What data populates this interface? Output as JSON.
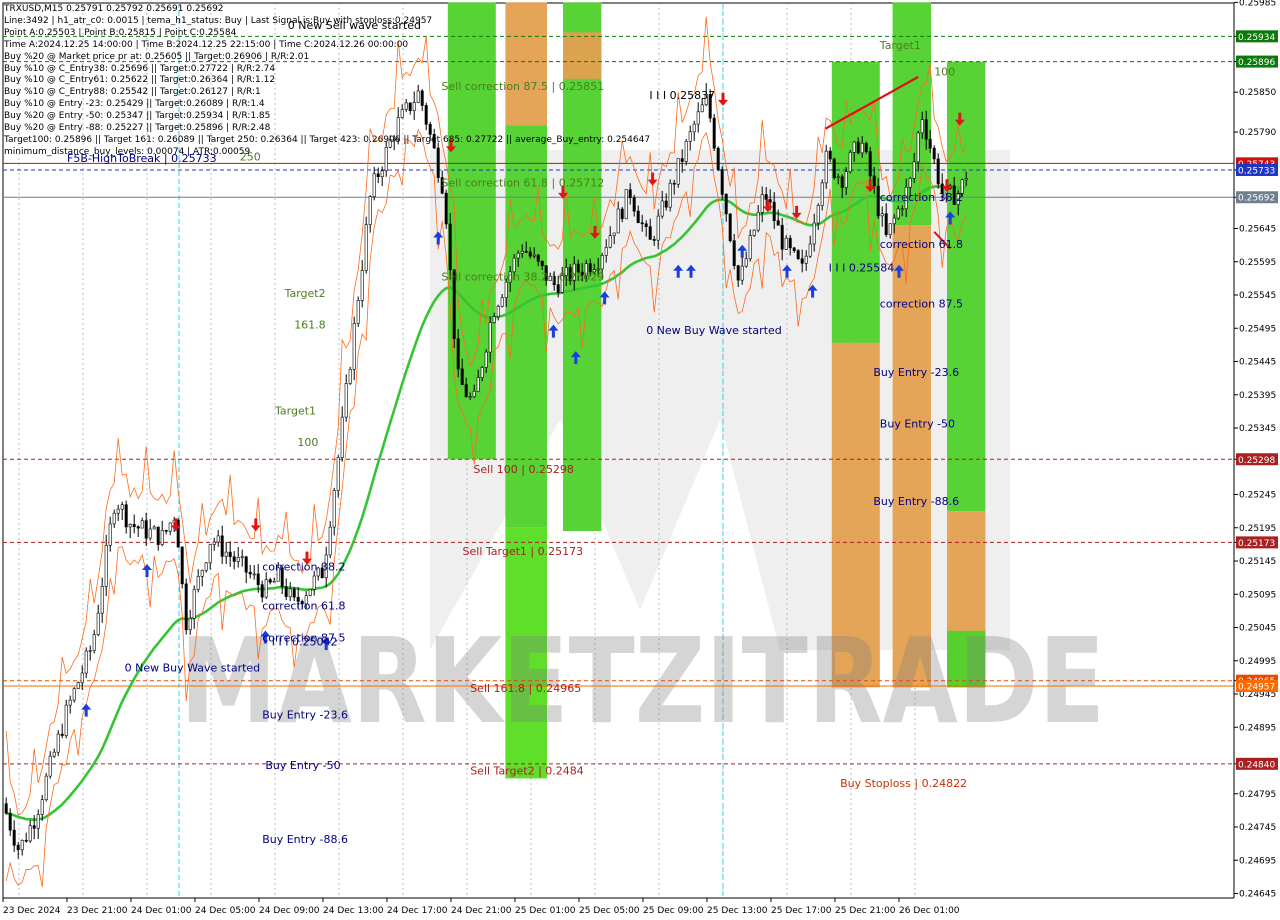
{
  "chart_data": {
    "type": "candlestick",
    "symbol_line": "TRXUSD,M15  0.25791 0.25792 0.25691 0.25692",
    "info_lines": [
      "Line:3492 | h1_atr_c0: 0.0015 | tema_h1_status: Buy | Last Signal is:Buy with stoploss:0.24957",
      "Point A:0.25503 | Point B:0.25815 | Point C:0.25584",
      "Time A:2024.12.25 14:00:00 | Time B:2024.12.25 22:15:00 | Time C:2024.12.26 00:00:00",
      "Buy %20 @ Market price pr at: 0.25605 || Target:0.26906 | R/R:2.01",
      "Buy %10 @ C_Entry38: 0.25696 || Target:0.27722 | R/R:2.74",
      "Buy %10 @ C_Entry61: 0.25622 || Target:0.26364 | R/R:1.12",
      "Buy %10 @ C_Entry88: 0.25542 || Target:0.26127 | R/R:1",
      "Buy %10 @ Entry -23: 0.25429 || Target:0.26089 | R/R:1.4",
      "Buy %20 @ Entry -50: 0.25347 || Target:0.25934 | R/R:1.85",
      "Buy %20 @ Entry -88: 0.25227 || Target:0.25896 | R/R:2.48",
      "Target100: 0.25896 || Target 161: 0.26089 || Target 250: 0.26364 || Target 423: 0.26906 || Target 685: 0.27722 || average_Buy_entry: 0.254647",
      "minimum_distance_buy_levels: 0.00074 | ATR:0.00059"
    ],
    "ylim": [
      0.24645,
      0.25985
    ],
    "y_ticks": [
      "0.25985",
      "0.25934",
      "0.25896",
      "0.25850",
      "0.25790",
      "0.25733",
      "0.25692",
      "0.25645",
      "0.25595",
      "0.25545",
      "0.25495",
      "0.25445",
      "0.25395",
      "0.25345",
      "0.25298",
      "0.25245",
      "0.25195",
      "0.25173",
      "0.25145",
      "0.25095",
      "0.25045",
      "0.24995",
      "0.24965",
      "0.24945",
      "0.24895",
      "0.24840",
      "0.24795",
      "0.24745",
      "0.24695",
      "0.24645"
    ],
    "x_ticks": [
      "23 Dec 2024",
      "23 Dec 21:00",
      "24 Dec 01:00",
      "24 Dec 05:00",
      "24 Dec 09:00",
      "24 Dec 13:00",
      "24 Dec 17:00",
      "24 Dec 21:00",
      "25 Dec 01:00",
      "25 Dec 05:00",
      "25 Dec 09:00",
      "25 Dec 13:00",
      "25 Dec 17:00",
      "25 Dec 21:00",
      "26 Dec 01:00"
    ],
    "price_levels": [
      {
        "price": 0.25934,
        "label": "0.25934",
        "color": "#0a7a0a",
        "style": "dashed"
      },
      {
        "price": 0.25896,
        "label": "0.25896",
        "color": "#0a7a0a",
        "style": "dashed"
      },
      {
        "price": 0.25743,
        "label": "0.25743",
        "color": "#cc1010",
        "style": "solid"
      },
      {
        "price": 0.25733,
        "label": "0.25733",
        "color": "#1f35c9",
        "style": "dashed"
      },
      {
        "price": 0.25692,
        "label": "0.25692",
        "color": "#6f7f8f",
        "style": "solid"
      },
      {
        "price": 0.25298,
        "label": "0.25298",
        "color": "#aa2020",
        "style": "dashed"
      },
      {
        "price": 0.25173,
        "label": "0.25173",
        "color": "#aa2020",
        "style": "dashed"
      },
      {
        "price": 0.24965,
        "label": "0.24965",
        "color": "#e44a00",
        "style": "dashed"
      },
      {
        "price": 0.24957,
        "label": "0.24957",
        "color": "#ff6a00",
        "style": "solid"
      },
      {
        "price": 0.2484,
        "label": "0.24840",
        "color": "#aa2020",
        "style": "dashed"
      }
    ],
    "annotations": [
      {
        "text": "0 New Sell wave started",
        "price": 0.25945,
        "time": 4.45,
        "color": "#000000"
      },
      {
        "text": "Target1",
        "price": 0.25915,
        "time": 13.7,
        "color": "#4a7d20"
      },
      {
        "text": "100",
        "price": 0.25875,
        "time": 14.55,
        "color": "#4a7d20"
      },
      {
        "text": "250",
        "price": 0.25747,
        "time": 3.7,
        "color": "#4a7d20"
      },
      {
        "text": "F5B-HighToBreak | 0.25733",
        "price": 0.25745,
        "time": 1.0,
        "color": "#000080"
      },
      {
        "text": "I I I 0.25837",
        "price": 0.2584,
        "time": 10.1,
        "color": "#000000"
      },
      {
        "text": "Sell correction 87.5 | 0.25851",
        "price": 0.25853,
        "time": 6.85,
        "color": "#4a7d20"
      },
      {
        "text": "Sell correction 61.8 | 0.25712",
        "price": 0.25708,
        "time": 6.85,
        "color": "#4a7d20"
      },
      {
        "text": "Sell correction 38.2 | 0.25629",
        "price": 0.25567,
        "time": 6.85,
        "color": "#4a7d20"
      },
      {
        "text": "Target2",
        "price": 0.25542,
        "time": 4.4,
        "color": "#4a7d20"
      },
      {
        "text": "161.8",
        "price": 0.25495,
        "time": 4.55,
        "color": "#4a7d20"
      },
      {
        "text": "Target1",
        "price": 0.25365,
        "time": 4.25,
        "color": "#4a7d20"
      },
      {
        "text": "100",
        "price": 0.25318,
        "time": 4.6,
        "color": "#4a7d20"
      },
      {
        "text": "0 New Buy Wave started",
        "price": 0.25486,
        "time": 10.05,
        "color": "#000080"
      },
      {
        "text": "I I I 0.25584",
        "price": 0.2558,
        "time": 12.9,
        "color": "#000080"
      },
      {
        "text": "correction 38.2",
        "price": 0.25686,
        "time": 13.7,
        "color": "#000080"
      },
      {
        "text": "correction 61.8",
        "price": 0.25616,
        "time": 13.7,
        "color": "#000080"
      },
      {
        "text": "correction 87.5",
        "price": 0.25526,
        "time": 13.7,
        "color": "#000080"
      },
      {
        "text": "Buy Entry -23.6",
        "price": 0.25423,
        "time": 13.6,
        "color": "#000080"
      },
      {
        "text": "Buy Entry -50",
        "price": 0.25346,
        "time": 13.7,
        "color": "#000080"
      },
      {
        "text": "Buy Entry -88.6",
        "price": 0.25229,
        "time": 13.6,
        "color": "#000080"
      },
      {
        "text": "Sell 100 | 0.25298",
        "price": 0.25277,
        "time": 7.35,
        "color": "#aa2020"
      },
      {
        "text": "Sell Target1 | 0.25173",
        "price": 0.25154,
        "time": 7.18,
        "color": "#aa2020"
      },
      {
        "text": "Sell 161.8 | 0.24965",
        "price": 0.24948,
        "time": 7.3,
        "color": "#aa2020"
      },
      {
        "text": "Sell Target2 | 0.2484",
        "price": 0.24824,
        "time": 7.3,
        "color": "#aa2020"
      },
      {
        "text": "Buy Stoploss | 0.24822",
        "price": 0.24805,
        "time": 13.08,
        "color": "#cc3000"
      },
      {
        "text": "correction 38.2",
        "price": 0.25131,
        "time": 4.05,
        "color": "#000080"
      },
      {
        "text": "correction 61.8",
        "price": 0.25072,
        "time": 4.05,
        "color": "#000080"
      },
      {
        "text": "I I I 0.25042",
        "price": 0.25018,
        "time": 4.2,
        "color": "#000080"
      },
      {
        "text": "correction 87.5",
        "price": 0.25024,
        "time": 4.05,
        "color": "#000080"
      },
      {
        "text": "0 New Buy Wave started",
        "price": 0.24979,
        "time": 1.9,
        "color": "#000080"
      },
      {
        "text": "Buy Entry -23.6",
        "price": 0.24908,
        "time": 4.05,
        "color": "#000080"
      },
      {
        "text": "Buy Entry -50",
        "price": 0.24832,
        "time": 4.1,
        "color": "#000080"
      },
      {
        "text": "Buy Entry -88.6",
        "price": 0.24721,
        "time": 4.05,
        "color": "#000080"
      }
    ],
    "watermark": "MARKETZITRADE"
  }
}
